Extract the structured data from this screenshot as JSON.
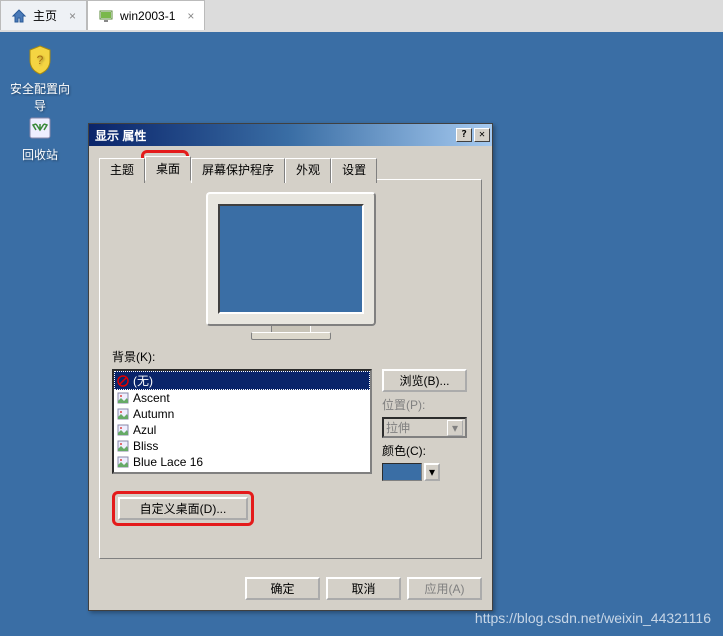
{
  "tabs": {
    "home": "主页",
    "vm": "win2003-1"
  },
  "desktop": {
    "scw": "安全配置向导",
    "recycle": "回收站"
  },
  "dialog": {
    "title": "显示 属性",
    "tabs": {
      "theme": "主题",
      "desktop": "桌面",
      "screensaver": "屏幕保护程序",
      "appearance": "外观",
      "settings": "设置"
    },
    "bg_label": "背景(K):",
    "bg_items": {
      "none": "(无)",
      "ascent": "Ascent",
      "autumn": "Autumn",
      "azul": "Azul",
      "bliss": "Bliss",
      "bluelace": "Blue Lace 16"
    },
    "browse": "浏览(B)...",
    "position_label": "位置(P):",
    "position_value": "拉伸",
    "color_label": "颜色(C):",
    "custom": "自定义桌面(D)...",
    "ok": "确定",
    "cancel": "取消",
    "apply": "应用(A)"
  },
  "watermark": "https://blog.csdn.net/weixin_44321116"
}
